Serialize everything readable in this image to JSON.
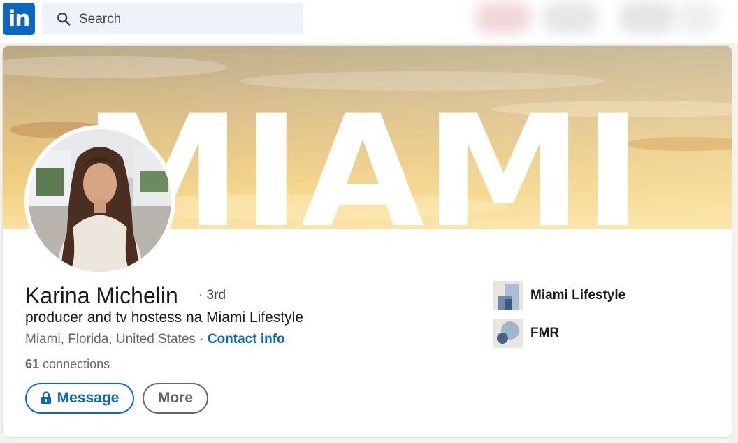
{
  "header": {
    "logo_text": "in",
    "search_placeholder": "Search"
  },
  "banner": {
    "text": "MIAMI"
  },
  "profile": {
    "name": "Karina Michelin",
    "degree": "· 3rd",
    "headline": "producer and tv hostess na Miami Lifestyle",
    "location": "Miami, Florida, United States ·",
    "contact_info": "Contact info",
    "connections_count": "61",
    "connections_label": "connections"
  },
  "actions": {
    "message_label": "Message",
    "more_label": "More"
  },
  "organizations": [
    {
      "name": "Miami Lifestyle"
    },
    {
      "name": "FMR"
    }
  ],
  "colors": {
    "brand": "#0a66c2",
    "text_primary": "#191919",
    "text_secondary": "#666666",
    "background": "#f4f2ee"
  },
  "icons": [
    "linkedin-logo-icon",
    "search-icon",
    "lock-icon",
    "company-logo-icon"
  ]
}
